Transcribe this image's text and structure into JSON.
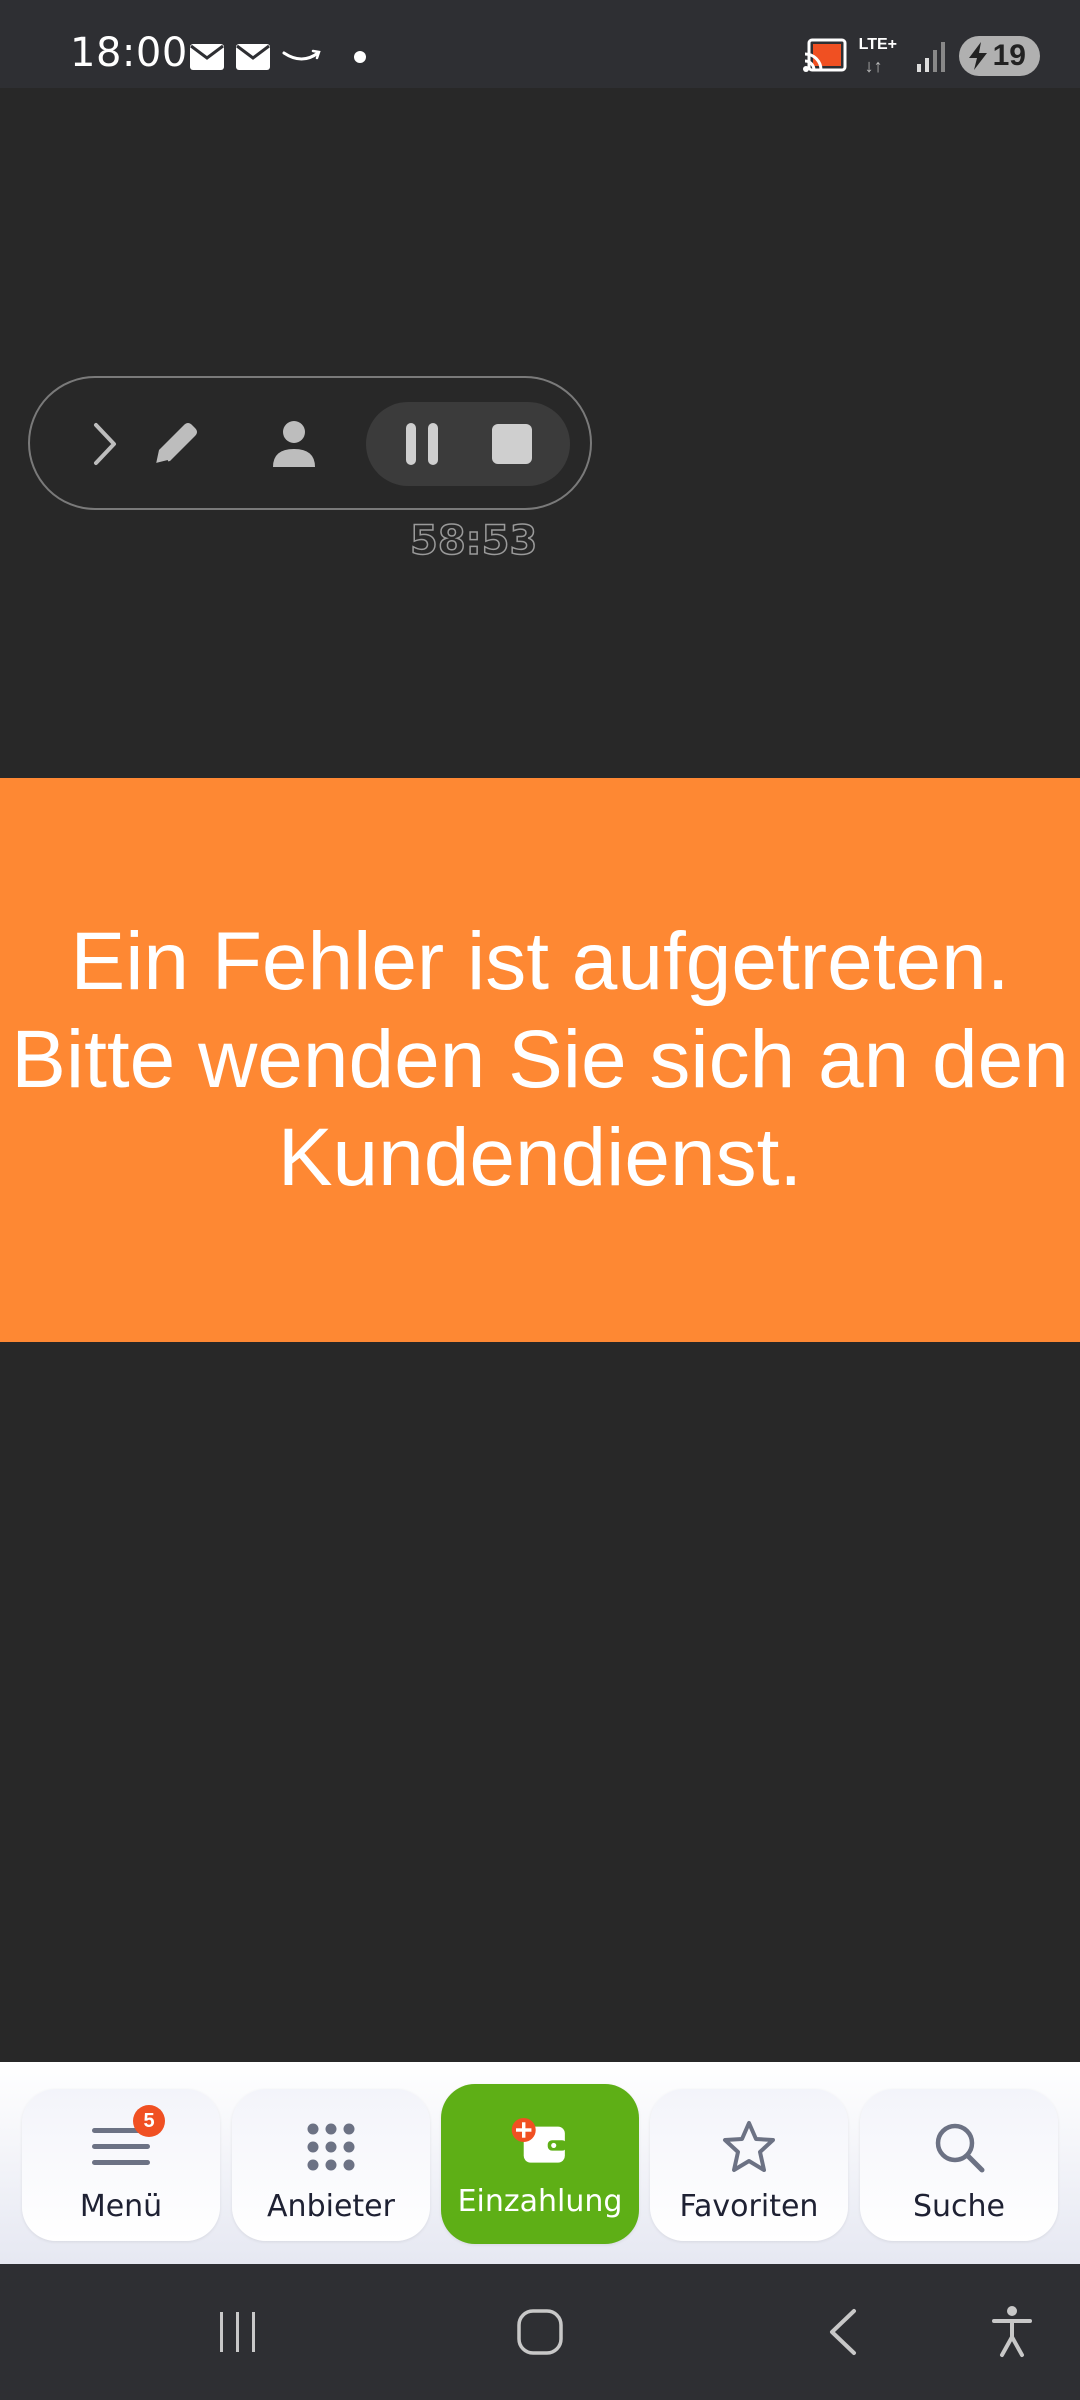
{
  "status_bar": {
    "time": "18:00",
    "network": "LTE+",
    "battery": "19",
    "icons": [
      "mail-icon",
      "mail-icon",
      "amazon-icon",
      "dot-icon",
      "cast-icon",
      "signal-icon",
      "battery-charging-icon"
    ]
  },
  "recorder": {
    "timer": "58:53",
    "buttons": [
      "expand-icon",
      "pen-icon",
      "person-icon",
      "pause-icon",
      "stop-icon"
    ]
  },
  "error_message": "Ein Fehler ist aufgetreten. Bitte wenden Sie sich an den Kundendienst.",
  "bottom_nav": {
    "items": [
      {
        "label": "Menü",
        "icon": "menu-icon",
        "badge": "5"
      },
      {
        "label": "Anbieter",
        "icon": "grid-icon"
      },
      {
        "label": "Einzahlung",
        "icon": "wallet-add-icon",
        "active": true
      },
      {
        "label": "Favoriten",
        "icon": "star-icon"
      },
      {
        "label": "Suche",
        "icon": "search-icon"
      }
    ]
  },
  "system_nav": [
    "recents-icon",
    "home-icon",
    "back-icon",
    "accessibility-icon"
  ],
  "colors": {
    "background": "#282828",
    "banner": "#FE8833",
    "active_nav": "#5EAF16",
    "badge": "#F05022"
  }
}
